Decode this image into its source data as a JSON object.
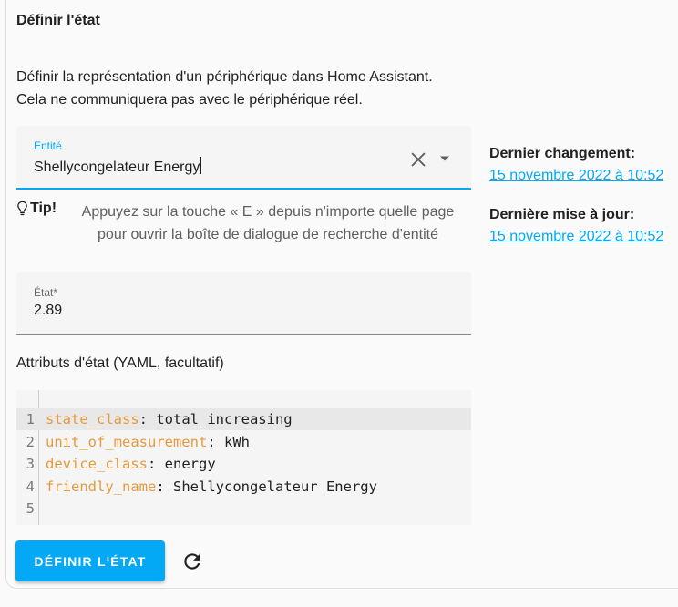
{
  "title": "Définir l'état",
  "description": {
    "line1": "Définir la représentation d'un périphérique dans Home Assistant.",
    "line2": "Cela ne communiquera pas avec le périphérique réel."
  },
  "entity": {
    "label": "Entité",
    "value": "Shellycongelateur Energy"
  },
  "tip": {
    "label": "Tip!",
    "line1": "Appuyez sur la touche « E » depuis n'importe quelle page",
    "line2": "pour ouvrir la boîte de dialogue de recherche d'entité"
  },
  "state": {
    "label": "État*",
    "value": "2.89"
  },
  "attributes": {
    "label": "Attributs d'état (YAML, facultatif)",
    "lines": [
      {
        "num": "1",
        "key": "state_class",
        "value": "total_increasing"
      },
      {
        "num": "2",
        "key": "unit_of_measurement",
        "value": "kWh"
      },
      {
        "num": "3",
        "key": "device_class",
        "value": "energy"
      },
      {
        "num": "4",
        "key": "friendly_name",
        "value": "Shellycongelateur Energy"
      },
      {
        "num": "5",
        "key": "",
        "value": ""
      }
    ]
  },
  "side": {
    "last_changed_label": "Dernier changement:",
    "last_changed_value": "15 novembre 2022 à 10:52",
    "last_updated_label": "Dernière mise à jour:",
    "last_updated_value": "15 novembre 2022 à 10:52"
  },
  "actions": {
    "set_state_label": "DÉFINIR L'ÉTAT"
  },
  "icons": {
    "clear": "close-icon",
    "dropdown": "menu-down-icon",
    "tip": "lightbulb-icon",
    "refresh": "refresh-icon"
  },
  "colors": {
    "accent": "#03a9f4",
    "yaml_key": "#e8993c"
  }
}
